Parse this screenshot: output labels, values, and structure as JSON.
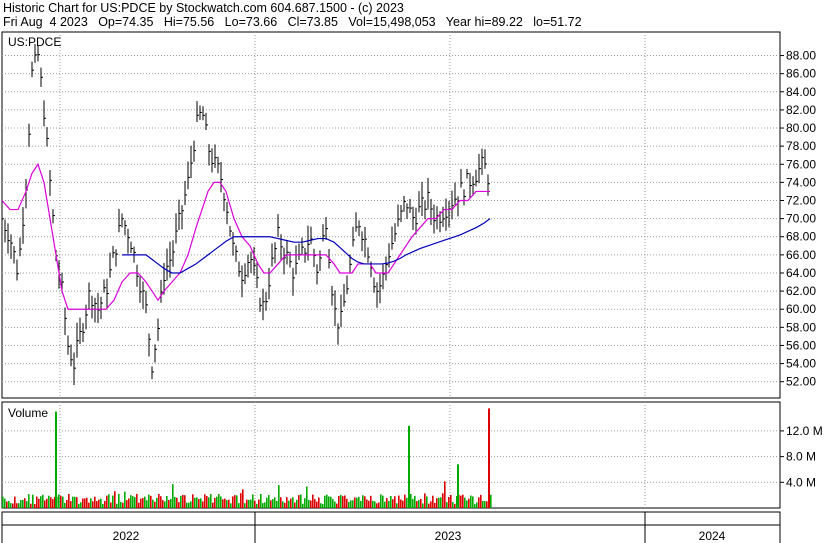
{
  "header": {
    "line1": "Historic Chart for US:PDCE by Stockwatch.com 604.687.1500 - (c) 2023",
    "line2": "Fri Aug  4 2023   Op=74.35   Hi=75.56   Lo=73.66   Cl=73.85   Vol=15,498,053   Year hi=89.22   lo=51.72"
  },
  "chart_data": [
    {
      "type": "line",
      "panel": "price",
      "label": "US:PDCE",
      "y_ticks": [
        "88.00",
        "86.00",
        "84.00",
        "82.00",
        "80.00",
        "78.00",
        "76.00",
        "74.00",
        "72.00",
        "70.00",
        "68.00",
        "66.00",
        "64.00",
        "62.00",
        "60.00",
        "58.00",
        "56.00",
        "54.00",
        "52.00"
      ],
      "ylim": [
        50.2,
        90.6
      ],
      "grid": true,
      "colors": {
        "price": "#000000",
        "short_ma": "#dd00dd",
        "long_ma": "#0000bb"
      },
      "x": [
        0,
        8,
        16,
        24,
        30,
        36,
        42,
        48,
        54,
        60,
        66,
        72,
        80,
        88,
        96,
        104,
        112,
        120,
        128,
        136,
        144,
        150,
        156,
        162,
        170,
        178,
        186,
        194,
        200,
        206,
        212,
        218,
        224,
        232,
        240,
        248,
        256,
        262,
        268,
        276,
        284,
        292,
        300,
        308,
        316,
        324,
        332,
        338,
        344,
        350,
        356,
        362,
        368,
        374,
        380,
        386,
        392,
        398,
        404,
        410,
        418,
        426,
        434,
        442,
        450,
        458,
        466,
        474,
        482,
        488
      ],
      "values": [
        70,
        68,
        64,
        74,
        86,
        88,
        82,
        74,
        66,
        62,
        56,
        54,
        58,
        62,
        60,
        62,
        66,
        70,
        68,
        64,
        60,
        54,
        58,
        64,
        66,
        70,
        74,
        80,
        82,
        78,
        76,
        75,
        72,
        66,
        64,
        66,
        62,
        60,
        64,
        68,
        66,
        64,
        66,
        68,
        64,
        70,
        60,
        58,
        62,
        66,
        70,
        68,
        66,
        62,
        63,
        66,
        68,
        70,
        72,
        70,
        71,
        72,
        70,
        71,
        72,
        73,
        74,
        75,
        76,
        74
      ],
      "series_short_ma": [
        72,
        71,
        71,
        73,
        75,
        76,
        74,
        70,
        66,
        62,
        60,
        60,
        60,
        60,
        60,
        60,
        61,
        63,
        64,
        64,
        63,
        62,
        61,
        62,
        63,
        64,
        66,
        69,
        71,
        73,
        74,
        74,
        73,
        70,
        68,
        67,
        65,
        64,
        64,
        65,
        66,
        66,
        66,
        66,
        66,
        66,
        65,
        64,
        64,
        64,
        65,
        65,
        65,
        64,
        64,
        64,
        65,
        66,
        67,
        68,
        69,
        70,
        70,
        71,
        71,
        72,
        72,
        73,
        73,
        73
      ],
      "series_long_ma": [
        null,
        null,
        null,
        null,
        null,
        null,
        null,
        null,
        null,
        null,
        null,
        null,
        null,
        null,
        null,
        null,
        null,
        66,
        66,
        66,
        66,
        65.5,
        65,
        64.5,
        64,
        64,
        64.5,
        65,
        65.5,
        66,
        66.5,
        67,
        67.5,
        68,
        68,
        68,
        68,
        68,
        68,
        67.8,
        67.6,
        67.4,
        67.4,
        67.6,
        67.8,
        67.8,
        67.4,
        66.8,
        66.2,
        65.6,
        65.2,
        65,
        65,
        65,
        65,
        65.1,
        65.3,
        65.6,
        66,
        66.3,
        66.7,
        67,
        67.3,
        67.6,
        67.9,
        68.2,
        68.6,
        69,
        69.5,
        70
      ]
    },
    {
      "type": "bar",
      "panel": "volume",
      "label": "Volume",
      "y_ticks": [
        "12.0 M",
        "8.0 M",
        "4.0 M"
      ],
      "ylim": [
        0,
        16.5
      ],
      "grid": true,
      "colors": {
        "up": "#00aa00",
        "down": "#dd0000"
      },
      "x": [
        53,
        406,
        455,
        486
      ],
      "values": [
        15.0,
        12.8,
        6.8,
        15.5
      ]
    }
  ],
  "x_axis": {
    "labels": [
      "2022",
      "2023",
      "2024"
    ]
  }
}
